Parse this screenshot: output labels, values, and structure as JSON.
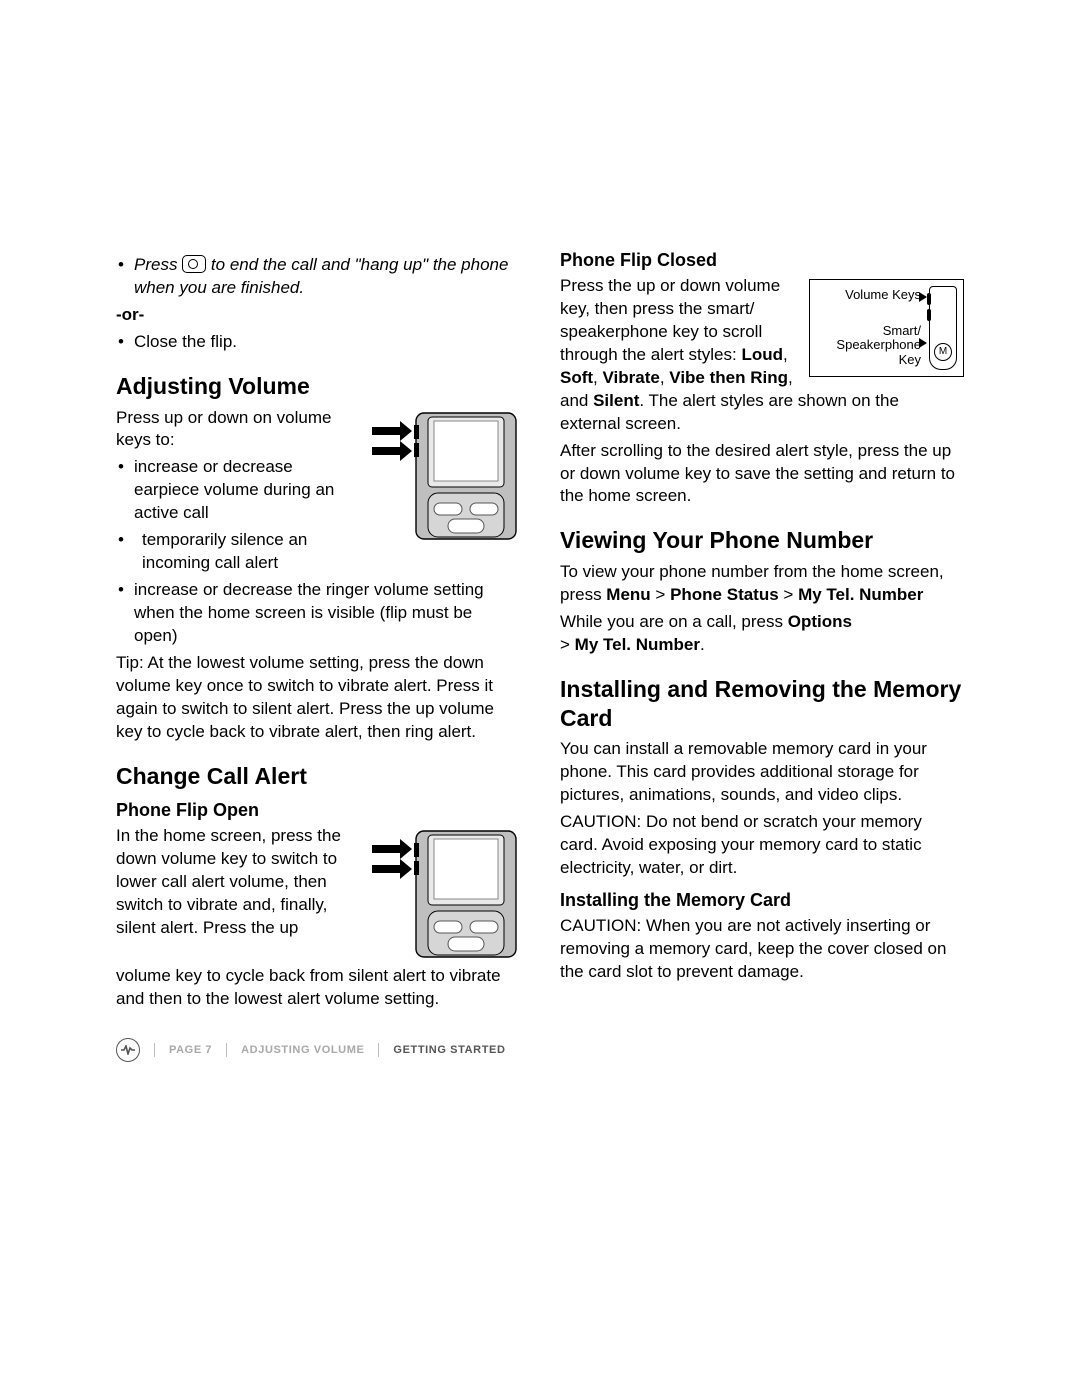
{
  "left": {
    "intro_bullet_prefix": "Press ",
    "intro_bullet_suffix": " to end the call and \"hang up\" the phone when you are finished.",
    "or": "-or-",
    "close_flip": "Close the flip.",
    "h_adjust": "Adjusting Volume",
    "adjust_p": "Press up or down on volume keys to:",
    "adjust_b1": "increase or decrease earpiece volume during an active call",
    "adjust_b2": "temporarily silence an incoming call alert",
    "adjust_b3": "increase or decrease the ringer volume setting when the home screen is visible (flip must be open)",
    "tip": "Tip: At the lowest volume setting, press the down volume key once to switch to vibrate alert. Press it again to switch to silent alert. Press the up volume key to cycle back to vibrate alert, then ring alert.",
    "h_change": "Change Call Alert",
    "sub_open": "Phone Flip Open",
    "open_p1": "In the home screen, press the down volume key to switch to lower call alert volume, then switch to vibrate and, finally, silent alert. Press the up",
    "open_p2": "volume key to cycle back from silent alert to vibrate and then to the lowest alert volume setting."
  },
  "right": {
    "sub_closed": "Phone Flip Closed",
    "closed_lbl_vk": "Volume Keys",
    "closed_lbl_sp": "Smart/ Speakerphone Key",
    "closed_p1a": "Press the up or down volume key, then press the smart/ speakerphone key to scroll through the alert styles: ",
    "closed_bold_loud": "Loud",
    "closed_p1b": ", ",
    "closed_bold_soft": "Soft",
    "closed_p1c": ", ",
    "closed_bold_vibrate": "Vibrate",
    "closed_p1d": ", ",
    "closed_bold_vtr": "Vibe then Ring",
    "closed_p1e": ", and ",
    "closed_bold_silent": "Silent",
    "closed_p1f": ". The alert styles are shown on the external screen.",
    "closed_p2": "After scrolling to the desired alert style, press the up or down volume key to save the setting and return to the home screen.",
    "h_view": "Viewing Your Phone Number",
    "view_p1a": "To view your phone number from the home screen, press ",
    "view_b_menu": "Menu",
    "view_gt1": " > ",
    "view_b_ps": "Phone Status",
    "view_gt2": " > ",
    "view_b_tel": "My Tel. Number",
    "view_p2a": "While you are on a call, press ",
    "view_b_opt": "Options",
    "view_p2b": " > ",
    "view_b_tel2": "My Tel. Number",
    "view_p2c": ".",
    "h_install": "Installing and Removing the Memory Card",
    "install_p1": "You can install a removable memory card in your phone. This card provides additional storage for pictures, animations, sounds, and video clips.",
    "install_p2": "CAUTION: Do not bend or scratch your memory card. Avoid exposing your memory card to static electricity, water, or dirt.",
    "sub_install": "Installing the Memory Card",
    "install_p3": "CAUTION: When you are not actively inserting or removing a memory card, keep the cover closed on the card slot to prevent damage."
  },
  "footer": {
    "page": "PAGE 7",
    "mid": "ADJUSTING VOLUME",
    "end": "GETTING STARTED"
  }
}
